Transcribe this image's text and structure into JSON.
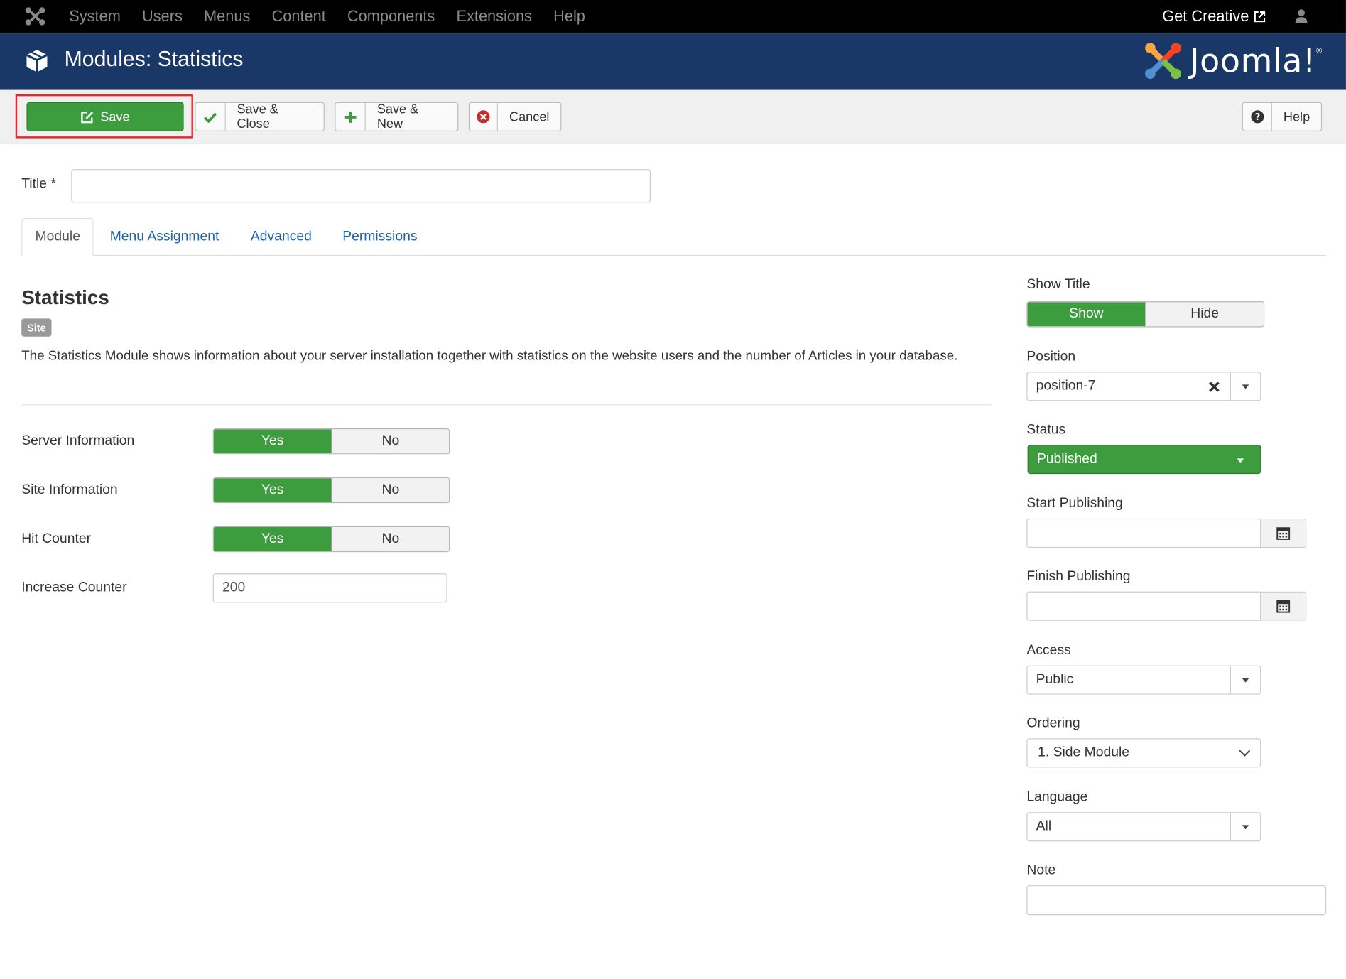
{
  "navbar": {
    "menu": [
      "System",
      "Users",
      "Menus",
      "Content",
      "Components",
      "Extensions",
      "Help"
    ],
    "site_link": "Get Creative"
  },
  "header": {
    "title": "Modules: Statistics",
    "logo_text": "Joomla!"
  },
  "toolbar": {
    "save": "Save",
    "save_close": "Save & Close",
    "save_new": "Save & New",
    "cancel": "Cancel",
    "help": "Help"
  },
  "form": {
    "title_label": "Title *",
    "title_value": "",
    "tabs": [
      "Module",
      "Menu Assignment",
      "Advanced",
      "Permissions"
    ],
    "active_tab": "Module"
  },
  "module": {
    "heading": "Statistics",
    "badge": "Site",
    "description": "The Statistics Module shows information about your server installation together with statistics on the website users and the number of Articles in your database.",
    "options": [
      {
        "label": "Server Information",
        "yes": "Yes",
        "no": "No",
        "selected": "Yes"
      },
      {
        "label": "Site Information",
        "yes": "Yes",
        "no": "No",
        "selected": "Yes"
      },
      {
        "label": "Hit Counter",
        "yes": "Yes",
        "no": "No",
        "selected": "Yes"
      }
    ],
    "increase_counter_label": "Increase Counter",
    "increase_counter_value": "200"
  },
  "sidebar": {
    "show_title_label": "Show Title",
    "show_title_on": "Show",
    "show_title_off": "Hide",
    "position_label": "Position",
    "position_value": "position-7",
    "status_label": "Status",
    "status_value": "Published",
    "start_label": "Start Publishing",
    "finish_label": "Finish Publishing",
    "access_label": "Access",
    "access_value": "Public",
    "ordering_label": "Ordering",
    "ordering_value": "1. Side Module",
    "language_label": "Language",
    "language_value": "All",
    "note_label": "Note",
    "note_value": ""
  },
  "colors": {
    "navbar": "#000000",
    "header": "#1a3867",
    "success": "#3c9c3e",
    "link": "#1f62a8",
    "highlight": "#e0282e"
  },
  "icons": [
    "joomla-icon",
    "external-link-icon",
    "user-icon",
    "cube-icon",
    "edit-icon",
    "check-icon",
    "plus-icon",
    "cancel-circle-icon",
    "help-icon",
    "close-x-icon",
    "chevron-down-icon",
    "calendar-icon"
  ]
}
